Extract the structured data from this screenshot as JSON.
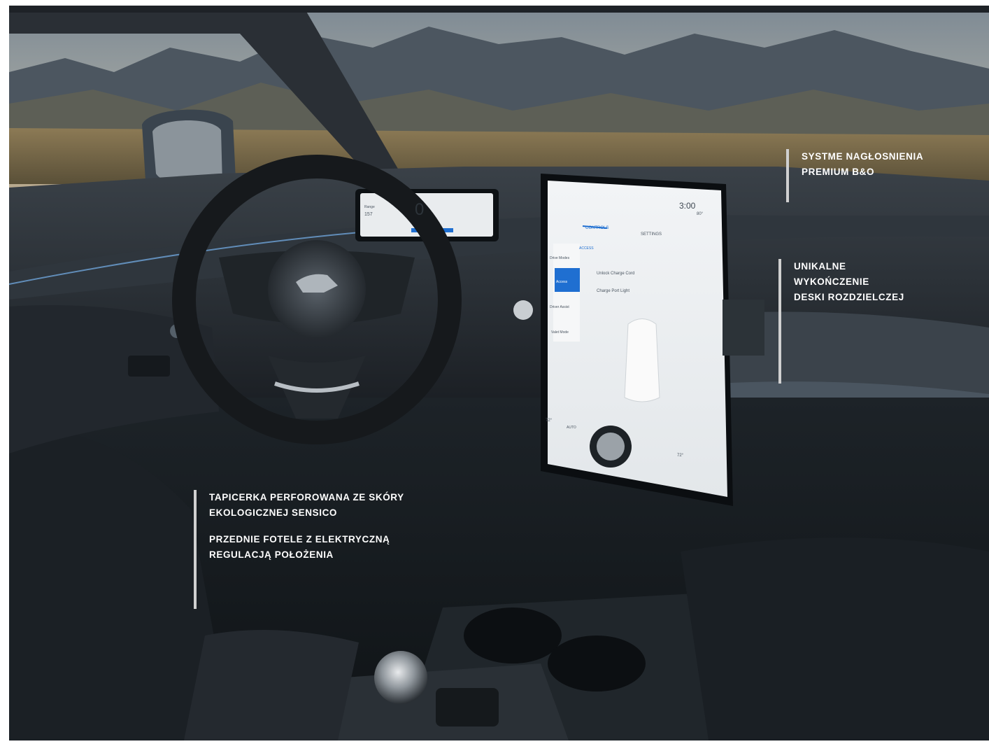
{
  "callouts": {
    "audio": {
      "line1": "SYSTME NAGŁOSNIENIA",
      "line2": "PREMIUM B&O"
    },
    "dash": {
      "line1": "UNIKALNE",
      "line2": "WYKOŃCZENIE",
      "line3": "DESKI ROZDZIELCZEJ"
    },
    "seats": {
      "a1": "TAPICERKA PERFOROWANA ZE SKÓRY",
      "a2": "EKOLOGICZNEJ SENSICO",
      "b1": "PRZEDNIE FOTELE Z ELEKTRYCZNĄ",
      "b2": "REGULACJĄ POŁOŻENIA"
    }
  },
  "screen": {
    "time": "3:00",
    "temp_status": "80°",
    "tab_controls": "CONTROLS",
    "tab_settings": "SETTINGS",
    "section": "ACCESS",
    "menu": [
      "Drive Modes",
      "Access",
      "Driver Assist",
      "Valet Mode"
    ],
    "item1": "Unlock Charge Cord",
    "item2": "Charge Port Light",
    "left_temp": "72°",
    "right_temp": "72°",
    "auto": "AUTO"
  },
  "cluster": {
    "speed": "0",
    "range_label": "Range",
    "range_value": "157"
  },
  "colors": {
    "callout_bar": "#d0d0d0",
    "callout_text": "#ffffff",
    "accent_blue": "#1f6fd1"
  }
}
